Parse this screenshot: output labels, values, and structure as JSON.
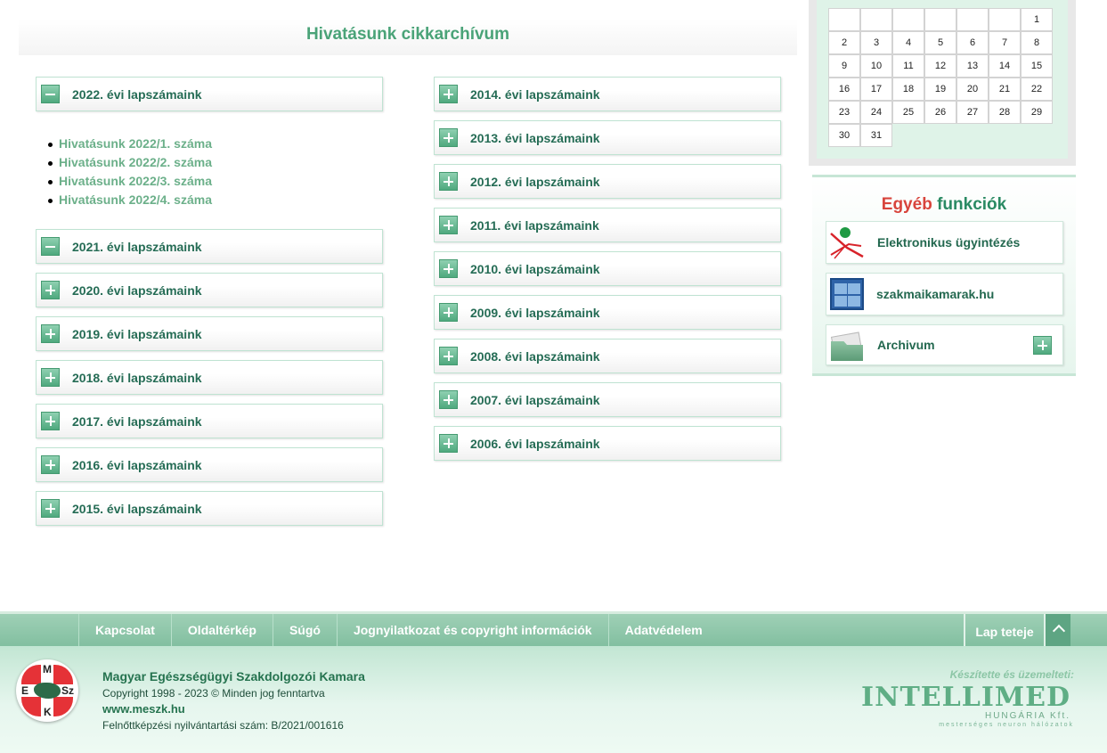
{
  "archive": {
    "title": "Hivatásunk cikkarchívum",
    "left_years": [
      {
        "label": "2022. évi lapszámaink",
        "expanded": true
      },
      {
        "label": "2021. évi lapszámaink",
        "expanded": true
      },
      {
        "label": "2020. évi lapszámaink",
        "expanded": false
      },
      {
        "label": "2019. évi lapszámaink",
        "expanded": false
      },
      {
        "label": "2018. évi lapszámaink",
        "expanded": false
      },
      {
        "label": "2017. évi lapszámaink",
        "expanded": false
      },
      {
        "label": "2016. évi lapszámaink",
        "expanded": false
      },
      {
        "label": "2015. évi lapszámaink",
        "expanded": false
      }
    ],
    "issues_2022": [
      "Hivatásunk 2022/1. száma",
      "Hivatásunk 2022/2. száma",
      "Hivatásunk 2022/3. száma",
      "Hivatásunk 2022/4. száma"
    ],
    "right_years": [
      {
        "label": "2014. évi lapszámaink",
        "expanded": false
      },
      {
        "label": "2013. évi lapszámaink",
        "expanded": false
      },
      {
        "label": "2012. évi lapszámaink",
        "expanded": false
      },
      {
        "label": "2011. évi lapszámaink",
        "expanded": false
      },
      {
        "label": "2010. évi lapszámaink",
        "expanded": false
      },
      {
        "label": "2009. évi lapszámaink",
        "expanded": false
      },
      {
        "label": "2008. évi lapszámaink",
        "expanded": false
      },
      {
        "label": "2007. évi lapszámaink",
        "expanded": false
      },
      {
        "label": "2006. évi lapszámaink",
        "expanded": false
      }
    ]
  },
  "calendar": {
    "leading_blanks": 6,
    "days": [
      "1",
      "2",
      "3",
      "4",
      "5",
      "6",
      "7",
      "8",
      "9",
      "10",
      "11",
      "12",
      "13",
      "14",
      "15",
      "16",
      "17",
      "18",
      "19",
      "20",
      "21",
      "22",
      "23",
      "24",
      "25",
      "26",
      "27",
      "28",
      "29",
      "30",
      "31"
    ]
  },
  "functions": {
    "title_part1": "Egyéb",
    "title_part2": "funkciók",
    "items": [
      {
        "label": "Elektronikus ügyintézés",
        "icon": "e-administration-icon"
      },
      {
        "label": "szakmaikamarak.hu",
        "icon": "chambers-portal-icon"
      },
      {
        "label": "Archivum",
        "icon": "archive-folder-icon"
      }
    ]
  },
  "footer": {
    "nav": [
      "Kapcsolat",
      "Oldaltérkép",
      "Súgó",
      "Jognyilatkozat és copyright információk",
      "Adatvédelem"
    ],
    "top_label": "Lap teteje",
    "org_name": "Magyar Egészségügyi Szakdolgozói Kamara",
    "copyright": "Copyright 1998 - 2023 © Minden jog fenntartva",
    "site": "www.meszk.hu",
    "registration": "Felnőttképzési nyilvántartási szám: B/2021/001616",
    "made_by": "Készítette és üzemelteti:",
    "brand": "INTELLIMED",
    "brand_sub": "HUNGÁRIA Kft.",
    "brand_tag": "mesterséges neuron hálózatok",
    "logo_letters": [
      "M",
      "E",
      "Sz",
      "K"
    ]
  },
  "colors": {
    "accent_green": "#4aa378",
    "link_green": "#6cb08a",
    "footer_bar": "#82bfa0",
    "title_red": "#d8443c"
  }
}
